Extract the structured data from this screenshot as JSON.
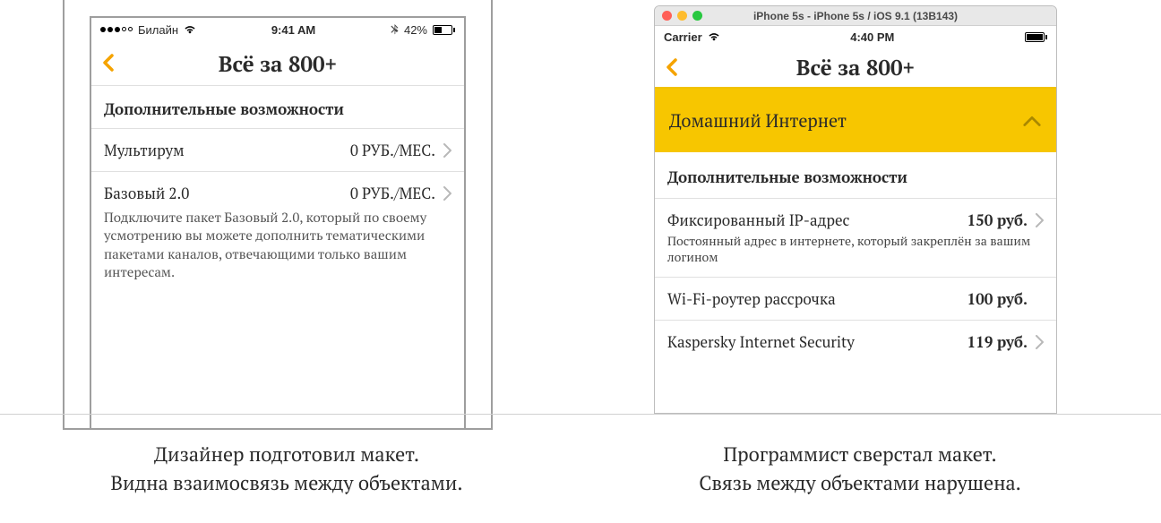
{
  "left": {
    "status": {
      "carrier": "Билайн",
      "time": "9:41 AM",
      "battery_pct": "42%"
    },
    "nav": {
      "title": "Всё за 800+"
    },
    "section_header": "Дополнительные возможности",
    "rows": [
      {
        "label": "Мультирум",
        "price": "0 РУБ./МЕС.",
        "desc": ""
      },
      {
        "label": "Базовый 2.0",
        "price": "0 РУБ./МЕС.",
        "desc": "Подключите пакет Базовый 2.0, который по своему усмотрению вы можете дополнить тематическими пакетами каналов, отвечающими только вашим интересам."
      }
    ],
    "caption_line1": "Дизайнер подготовил макет.",
    "caption_line2": "Видна взаимосвязь между объектами."
  },
  "right": {
    "window_title": "iPhone 5s - iPhone 5s / iOS 9.1 (13B143)",
    "status": {
      "carrier": "Carrier",
      "time": "4:40 PM"
    },
    "nav": {
      "title": "Всё за 800+"
    },
    "expander_label": "Домашний Интернет",
    "section_header": "Дополнительные возможности",
    "rows": [
      {
        "label": "Фиксированный IP-адрес",
        "price": "150 руб.",
        "desc": "Постоянный адрес в интернете, который закреплён за вашим логином"
      },
      {
        "label": "Wi-Fi-роутер рассрочка",
        "price": "100 руб.",
        "desc": ""
      },
      {
        "label": "Kaspersky Internet Security",
        "price": "119 руб.",
        "desc": ""
      }
    ],
    "caption_line1": "Программист сверстал макет.",
    "caption_line2": "Связь между объектами нарушена."
  }
}
